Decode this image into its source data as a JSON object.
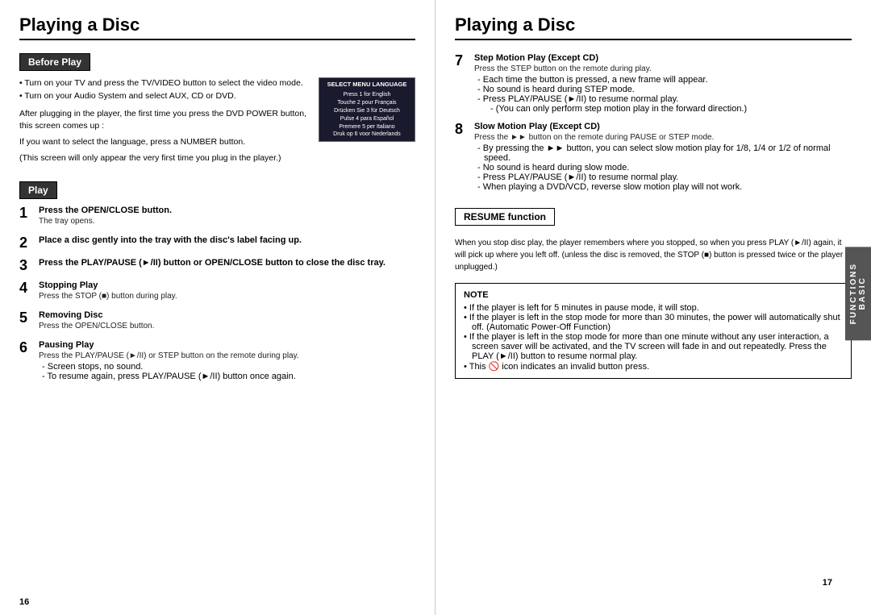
{
  "left_page": {
    "title": "Playing a Disc",
    "page_number": "16",
    "before_play": {
      "header": "Before Play",
      "bullets": [
        "Turn on your TV and press the TV/VIDEO button to select the video mode.",
        "Turn on your Audio System and select AUX, CD or DVD."
      ],
      "paragraph1": "After plugging in the player, the first time you press the DVD POWER button, this screen comes up :",
      "paragraph2": "If you want to select the language, press a NUMBER button.",
      "paragraph3": "(This screen will only appear the very first time you plug in the player.)"
    },
    "screen": {
      "title": "SELECT MENU LANGUAGE",
      "items": [
        "Press  1  for English",
        "Touche  2  pour Français",
        "Drücken Sie  3  für Deutsch",
        "Pulse  4  para Español",
        "Premere  5  per Italiano",
        "Druk op  6  voor Nederlands"
      ]
    },
    "play_section": {
      "header": "Play",
      "steps": [
        {
          "number": "1",
          "title": "Press the OPEN/CLOSE button.",
          "desc": "The tray opens."
        },
        {
          "number": "2",
          "title": "Place a disc gently into the tray with the disc's label facing up."
        },
        {
          "number": "3",
          "title": "Press the PLAY/PAUSE (►/II) button or OPEN/CLOSE button to close the disc tray."
        },
        {
          "number": "4",
          "title": "Stopping Play",
          "desc": "Press the STOP (■) button during play."
        },
        {
          "number": "5",
          "title": "Removing Disc",
          "desc": "Press the OPEN/CLOSE button."
        },
        {
          "number": "6",
          "title": "Pausing Play",
          "desc": "Press the PLAY/PAUSE (►/II) or STEP button on the remote during play.",
          "sub_items": [
            "Screen stops, no sound.",
            "To resume again, press PLAY/PAUSE (►/II) button once again."
          ]
        }
      ]
    }
  },
  "right_page": {
    "title": "Playing a Disc",
    "page_number": "17",
    "steps": [
      {
        "number": "7",
        "title": "Step Motion Play (Except CD)",
        "desc": "Press the STEP button on the remote during play.",
        "sub_items": [
          "Each time the button is pressed, a new frame will appear.",
          "No sound is heard during STEP mode.",
          "Press PLAY/PAUSE (►/II) to resume normal play.",
          "(You can only perform step motion play in the forward direction.)"
        ]
      },
      {
        "number": "8",
        "title": "Slow Motion Play (Except CD)",
        "desc": "Press the ►► button on the remote during PAUSE or STEP mode.",
        "sub_items": [
          "By pressing the ►► button, you can select slow motion play for 1/8, 1/4 or 1/2 of normal speed.",
          "No sound is heard during slow mode.",
          "Press PLAY/PAUSE (►/II) to resume normal play.",
          "When playing a DVD/VCD, reverse slow motion play will not work."
        ]
      }
    ],
    "resume": {
      "header": "RESUME function",
      "desc": "When you stop disc play, the player remembers where you stopped, so when you press PLAY (►/II) again, it will pick up where you left off. (unless the disc is removed, the STOP (■) button is pressed twice or the player is unplugged.)"
    },
    "note": {
      "header": "NOTE",
      "items": [
        "If the player is left for 5 minutes in pause mode, it will stop.",
        "If the player is left in the stop mode for more than 30 minutes, the power will automatically shut off. (Automatic Power-Off Function)",
        "If the player is left in the stop mode for more than one minute without any user interaction, a screen saver will be activated, and the TV screen will fade in and out repeatedly. Press the PLAY (►/II) button to resume normal play.",
        "This 🚫 icon indicates an invalid button press."
      ]
    },
    "sidebar_tab": {
      "line1": "BASIC",
      "line2": "FUNCTIONS"
    }
  }
}
